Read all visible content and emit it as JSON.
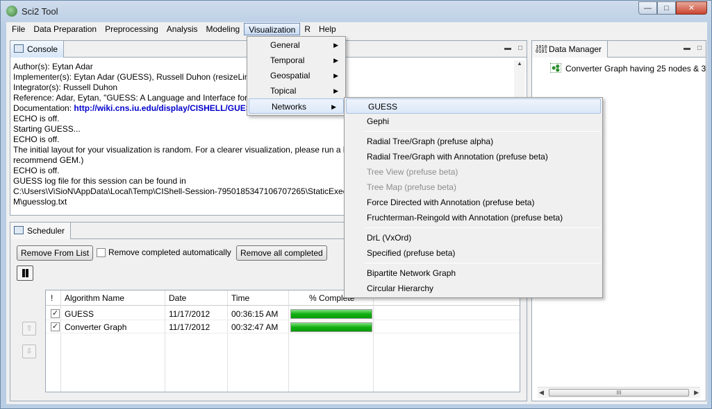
{
  "window": {
    "title": "Sci2 Tool"
  },
  "menubar": [
    "File",
    "Data Preparation",
    "Preprocessing",
    "Analysis",
    "Modeling",
    "Visualization",
    "R",
    "Help"
  ],
  "visualization_menu": {
    "items": [
      "General",
      "Temporal",
      "Geospatial",
      "Topical",
      "Networks"
    ]
  },
  "networks_menu": {
    "groups": [
      [
        {
          "label": "GUESS",
          "enabled": true
        },
        {
          "label": "Gephi",
          "enabled": true
        }
      ],
      [
        {
          "label": "Radial Tree/Graph (prefuse alpha)",
          "enabled": true
        },
        {
          "label": "Radial Tree/Graph with Annotation (prefuse beta)",
          "enabled": true
        },
        {
          "label": "Tree View (prefuse beta)",
          "enabled": false
        },
        {
          "label": "Tree Map (prefuse beta)",
          "enabled": false
        },
        {
          "label": "Force Directed with Annotation (prefuse beta)",
          "enabled": true
        },
        {
          "label": "Fruchterman-Reingold with Annotation (prefuse beta)",
          "enabled": true
        }
      ],
      [
        {
          "label": "DrL (VxOrd)",
          "enabled": true
        },
        {
          "label": "Specified (prefuse beta)",
          "enabled": true
        }
      ],
      [
        {
          "label": "Bipartite Network Graph",
          "enabled": true
        },
        {
          "label": "Circular Hierarchy",
          "enabled": true
        }
      ]
    ]
  },
  "console": {
    "tab": "Console",
    "lines": [
      "Author(s): Eytan Adar",
      "Implementer(s): Eytan Adar (GUESS), Russell Duhon (resizeLinea",
      "Integrator(s): Russell Duhon",
      "Reference: Adar, Eytan, \"GUESS: A Language and Interface for Gr",
      "ECHO is off.",
      "Starting GUESS...",
      "ECHO is off.",
      "The initial layout for your visualization is random.  For a clearer visualization, please run a l",
      "recommend GEM.)",
      "ECHO is off.",
      "GUESS log file for this session can be found in",
      "C:\\Users\\ViSioN\\AppData\\Local\\Temp\\CIShell-Session-7950185347106707265\\StaticExecut",
      "M\\guesslog.txt"
    ],
    "doc_prefix": "Documentation: ",
    "doc_link": "http://wiki.cns.iu.edu/display/CISHELL/GUESS"
  },
  "data_manager": {
    "tab": "Data Manager",
    "item": "Converter Graph having 25 nodes & 3",
    "scroll_thumb": "III"
  },
  "scheduler": {
    "tab": "Scheduler",
    "remove_from_list": "Remove From List",
    "remove_completed_auto": "Remove completed automatically",
    "remove_all_completed": "Remove all completed",
    "columns": [
      "!",
      "Algorithm Name",
      "Date",
      "Time",
      "% Complete"
    ],
    "rows": [
      {
        "name": "GUESS",
        "date": "11/17/2012",
        "time": "00:36:15 AM",
        "progress": 100
      },
      {
        "name": "Converter Graph",
        "date": "11/17/2012",
        "time": "00:32:47 AM",
        "progress": 100
      }
    ]
  }
}
